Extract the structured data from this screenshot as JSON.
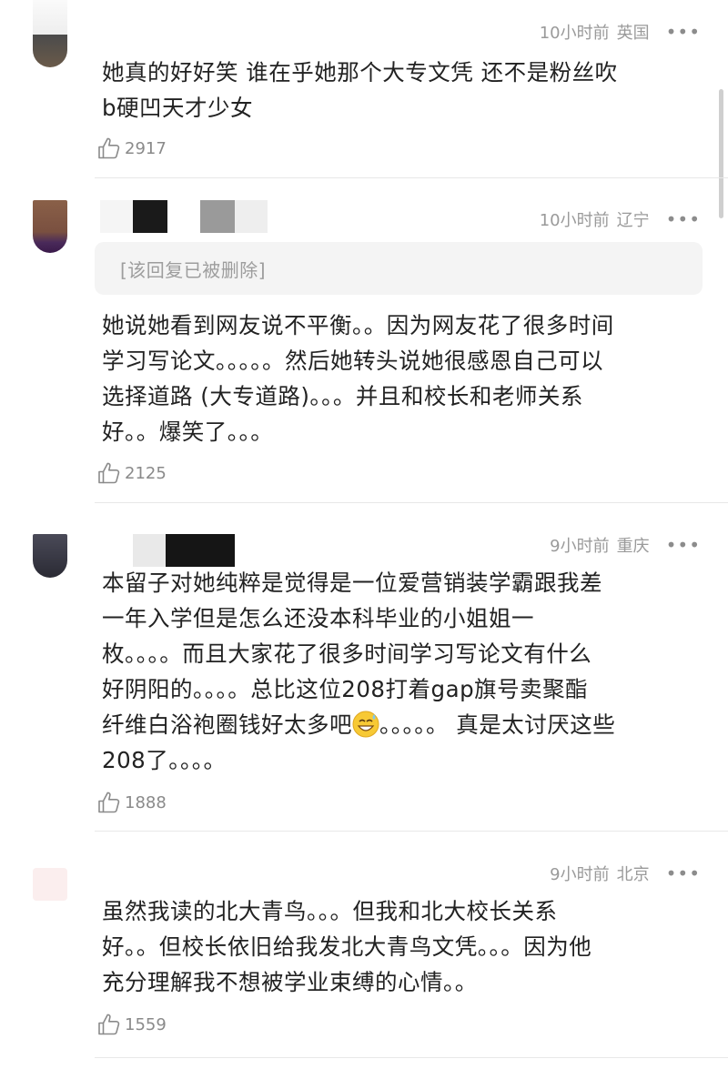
{
  "comments": [
    {
      "time": "10小时前",
      "location": "英国",
      "text_lines": [
        "她真的好好笑 谁在乎她那个大专文凭 还不是粉丝吹",
        "b硬凹天才少女"
      ],
      "likes": "2917",
      "icon": "thumbs-up-icon"
    },
    {
      "time": "10小时前",
      "location": "辽宁",
      "quoted_reply": "[该回复已被删除]",
      "text_lines": [
        "她说她看到网友说不平衡。。因为网友花了很多时间",
        "学习写论文。。。。。然后她转头说她很感恩自己可以",
        "选择道路 (大专道路)。。。并且和校长和老师关系",
        "好。。爆笑了。。。"
      ],
      "likes": "2125",
      "icon": "thumbs-up-icon"
    },
    {
      "time": "9小时前",
      "location": "重庆",
      "text_lines": [
        "本留子对她纯粹是觉得是一位爱营销装学霸跟我差",
        "一年入学但是怎么还没本科毕业的小姐姐一",
        "枚。。。。而且大家花了很多时间学习写论文有什么",
        "好阴阳的。。。。总比这位208打着gap旗号卖聚酯"
      ],
      "line5_before_emoji": "纤维白浴袍圈钱好太多吧",
      "line5_after_emoji": "。。。。。 真是太讨厌这些",
      "line6": "208了。。。。",
      "emoji": "grinning-sweat-emoji",
      "likes": "1888",
      "icon": "thumbs-up-icon"
    },
    {
      "time": "9小时前",
      "location": "北京",
      "text_lines": [
        "虽然我读的北大青鸟。。。但我和北大校长关系",
        "好。。但校长依旧给我发北大青鸟文凭。。。因为他",
        "充分理解我不想被学业束缚的心情。。"
      ],
      "likes": "1559",
      "icon": "thumbs-up-icon"
    }
  ],
  "more_icon": "•••",
  "colors": {
    "meta": "#9a9a9a",
    "text": "#222222",
    "bubble": "#f4f4f4"
  }
}
